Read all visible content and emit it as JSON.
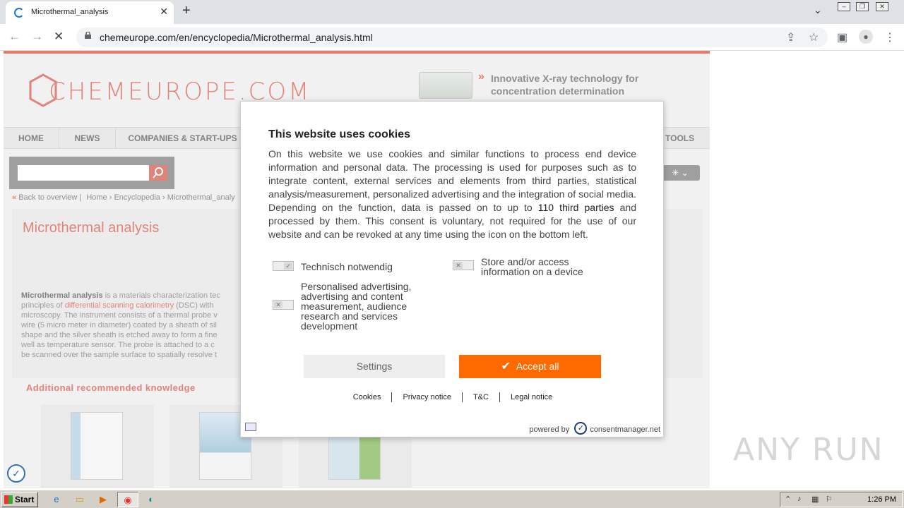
{
  "browser": {
    "tab_title": "Microthermal_analysis",
    "url": "chemeurope.com/en/encyclopedia/Microthermal_analysis.html"
  },
  "site": {
    "logo_text": "CHEMEUROPE.COM",
    "ad_text": "Innovative X-ray technology for concentration determination",
    "nav": [
      "HOME",
      "NEWS",
      "COMPANIES & START-UPS",
      "TOOLS"
    ],
    "language_icon": "flag-icon",
    "breadcrumb": {
      "back": "Back to overview |",
      "home": "Home",
      "encyclopedia": "Encyclopedia",
      "current": "Microthermal_analy"
    },
    "article_title": "Microthermal analysis",
    "article": {
      "bold": "Microthermal analysis",
      "p1": " is a materials characterization tec",
      "p2": "principles of ",
      "link": "differential scanning calorimetry",
      "p3": " (DSC) with",
      "p4": "microscopy. The instrument consists of a thermal probe v",
      "p5": "wire (5 micro meter in diameter) coated by a sheath of sil",
      "p6": "shape and the silver sheath is etched away to form a fine",
      "p7": "well as temperature sensor. The probe is attached to a c",
      "p8": "be scanned over the sample surface to spatially resolve t"
    },
    "recommended_title": "Additional recommended knowledge"
  },
  "cookie_dialog": {
    "title": "This website uses cookies",
    "body_1": "On this website we use cookies and similar functions to process end device information and personal data. The processing is used for purposes such as to integrate content, external services and elements from third parties, statistical analysis/measurement, personalized advertising and the integration of social media. Depending on the function, data is passed on to up to ",
    "third_parties": "110 third parties",
    "body_2": " and processed by them. This consent is voluntary, not required for the use of our website and can be revoked at any time using the icon on the bottom left.",
    "purpose_1": "Technisch notwendig",
    "purpose_2": "Store and/or access information on a device",
    "purpose_3": "Personalised advertising, advertising and content measurement, audience research and services development",
    "settings_label": "Settings",
    "accept_label": "Accept all",
    "links": [
      "Cookies",
      "Privacy notice",
      "T&C",
      "Legal notice"
    ],
    "powered_by": "powered by",
    "provider": "consentmanager.net"
  },
  "watermark": "ANY RUN",
  "taskbar": {
    "start_label": "Start",
    "clock": "1:26 PM"
  }
}
